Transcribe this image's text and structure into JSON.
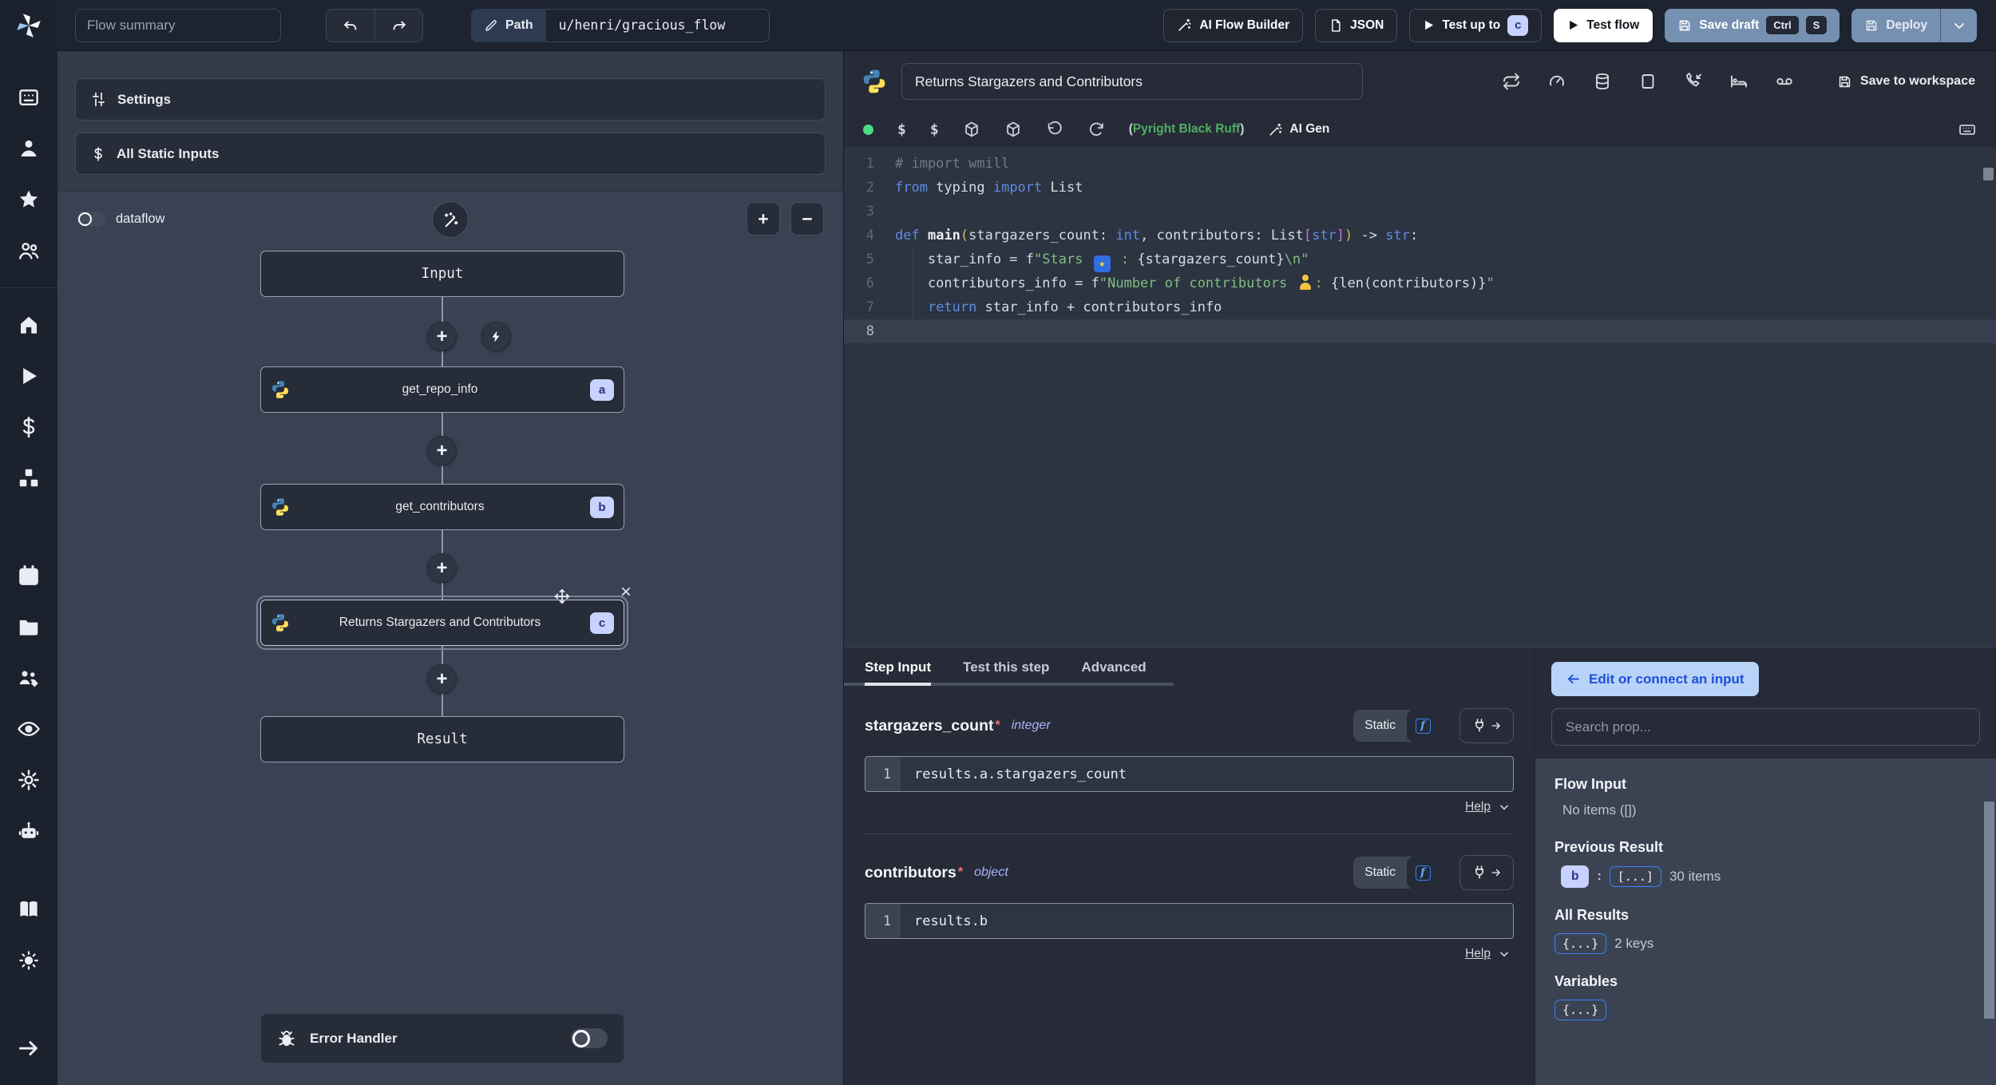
{
  "topbar": {
    "flow_summary_placeholder": "Flow summary",
    "path_label": "Path",
    "path_value": "u/henri/gracious_flow",
    "ai_flow_builder": "AI Flow Builder",
    "json_label": "JSON",
    "test_up_to": "Test up to",
    "test_up_to_badge": "c",
    "test_flow": "Test flow",
    "save_draft": "Save draft",
    "kbd_ctrl": "Ctrl",
    "kbd_s": "S",
    "deploy": "Deploy"
  },
  "flow_panel": {
    "settings": "Settings",
    "all_static_inputs": "All Static Inputs",
    "dataflow": "dataflow",
    "zoom_in": "+",
    "zoom_out": "−",
    "nodes": {
      "input": "Input",
      "steps": [
        {
          "label": "get_repo_info",
          "badge": "a"
        },
        {
          "label": "get_contributors",
          "badge": "b"
        },
        {
          "label": "Returns Stargazers and Contributors",
          "badge": "c"
        }
      ],
      "result": "Result",
      "error_handler": "Error Handler"
    }
  },
  "editor": {
    "title": "Returns Stargazers and Contributors",
    "save_to_workspace": "Save to workspace",
    "dollar1": "$",
    "dollar2": "$",
    "assistants_open": "(",
    "assistants": "Pyright Black Ruff",
    "assistants_close": ")",
    "ai_gen": "AI Gen",
    "code_lines": [
      [
        {
          "c": "comment",
          "t": "# import wmill"
        }
      ],
      [
        {
          "c": "kw",
          "t": "from"
        },
        {
          "c": "fg",
          "t": " typing "
        },
        {
          "c": "kw",
          "t": "import"
        },
        {
          "c": "fg",
          "t": " List"
        }
      ],
      [],
      [
        {
          "c": "kw",
          "t": "def"
        },
        {
          "c": "fg",
          "t": " "
        },
        {
          "c": "fn",
          "t": "main"
        },
        {
          "c": "br1",
          "t": "("
        },
        {
          "c": "fg",
          "t": "stargazers_count: "
        },
        {
          "c": "type",
          "t": "int"
        },
        {
          "c": "fg",
          "t": ", contributors: List"
        },
        {
          "c": "br2",
          "t": "["
        },
        {
          "c": "type",
          "t": "str"
        },
        {
          "c": "br2",
          "t": "]"
        },
        {
          "c": "br1",
          "t": ")"
        },
        {
          "c": "fg",
          "t": " -> "
        },
        {
          "c": "type",
          "t": "str"
        },
        {
          "c": "fg",
          "t": ":"
        }
      ],
      [
        {
          "c": "fg",
          "t": "    star_info = f"
        },
        {
          "c": "str",
          "t": "\"Stars "
        },
        {
          "e": "star"
        },
        {
          "c": "str",
          "t": " : "
        },
        {
          "c": "fg",
          "t": "{stargazers_count}"
        },
        {
          "c": "str",
          "t": "\\n\""
        }
      ],
      [
        {
          "c": "fg",
          "t": "    contributors_info = f"
        },
        {
          "c": "str",
          "t": "\"Number of contributors "
        },
        {
          "e": "person"
        },
        {
          "c": "str",
          "t": ": "
        },
        {
          "c": "fg",
          "t": "{len(contributors)}"
        },
        {
          "c": "str",
          "t": "\""
        }
      ],
      [
        {
          "c": "fg",
          "t": "    "
        },
        {
          "c": "kw",
          "t": "return"
        },
        {
          "c": "fg",
          "t": " star_info + contributors_info"
        }
      ],
      []
    ]
  },
  "step_io": {
    "tabs": [
      "Step Input",
      "Test this step",
      "Advanced"
    ],
    "params": [
      {
        "name": "stargazers_count",
        "required": "*",
        "type": "integer",
        "mode": "Static",
        "line_no": "1",
        "expr": "results.a.stargazers_count",
        "help": "Help"
      },
      {
        "name": "contributors",
        "required": "*",
        "type": "object",
        "mode": "Static",
        "line_no": "1",
        "expr": "results.b",
        "help": "Help"
      }
    ]
  },
  "prop_picker": {
    "edit_connect": "Edit or connect an input",
    "search_placeholder": "Search prop...",
    "flow_input_title": "Flow Input",
    "flow_input_empty": "No items ([])",
    "previous_result_title": "Previous Result",
    "previous_result_key": "b",
    "previous_result_collapsed": "[...]",
    "previous_result_count": "30 items",
    "all_results_title": "All Results",
    "all_results_collapsed": "{...}",
    "all_results_count": "2 keys",
    "variables_title": "Variables",
    "variables_collapsed": "{...}"
  },
  "colors": {
    "accent_steel_blue": "#7590b0",
    "badge_bg": "#c7d2fe",
    "badge_text": "#312e81",
    "connect_btn_bg": "#b9d3f8",
    "connect_btn_text": "#1d4fd8",
    "lsp_dot_green": "#4ade80",
    "assistant_green": "#4fae63",
    "string_green": "#7fbf7f",
    "keyword_blue": "#5d8de5",
    "panel_bg": "#333a49",
    "graph_bg": "#3a4152",
    "editor_bg": "#2c3341"
  }
}
